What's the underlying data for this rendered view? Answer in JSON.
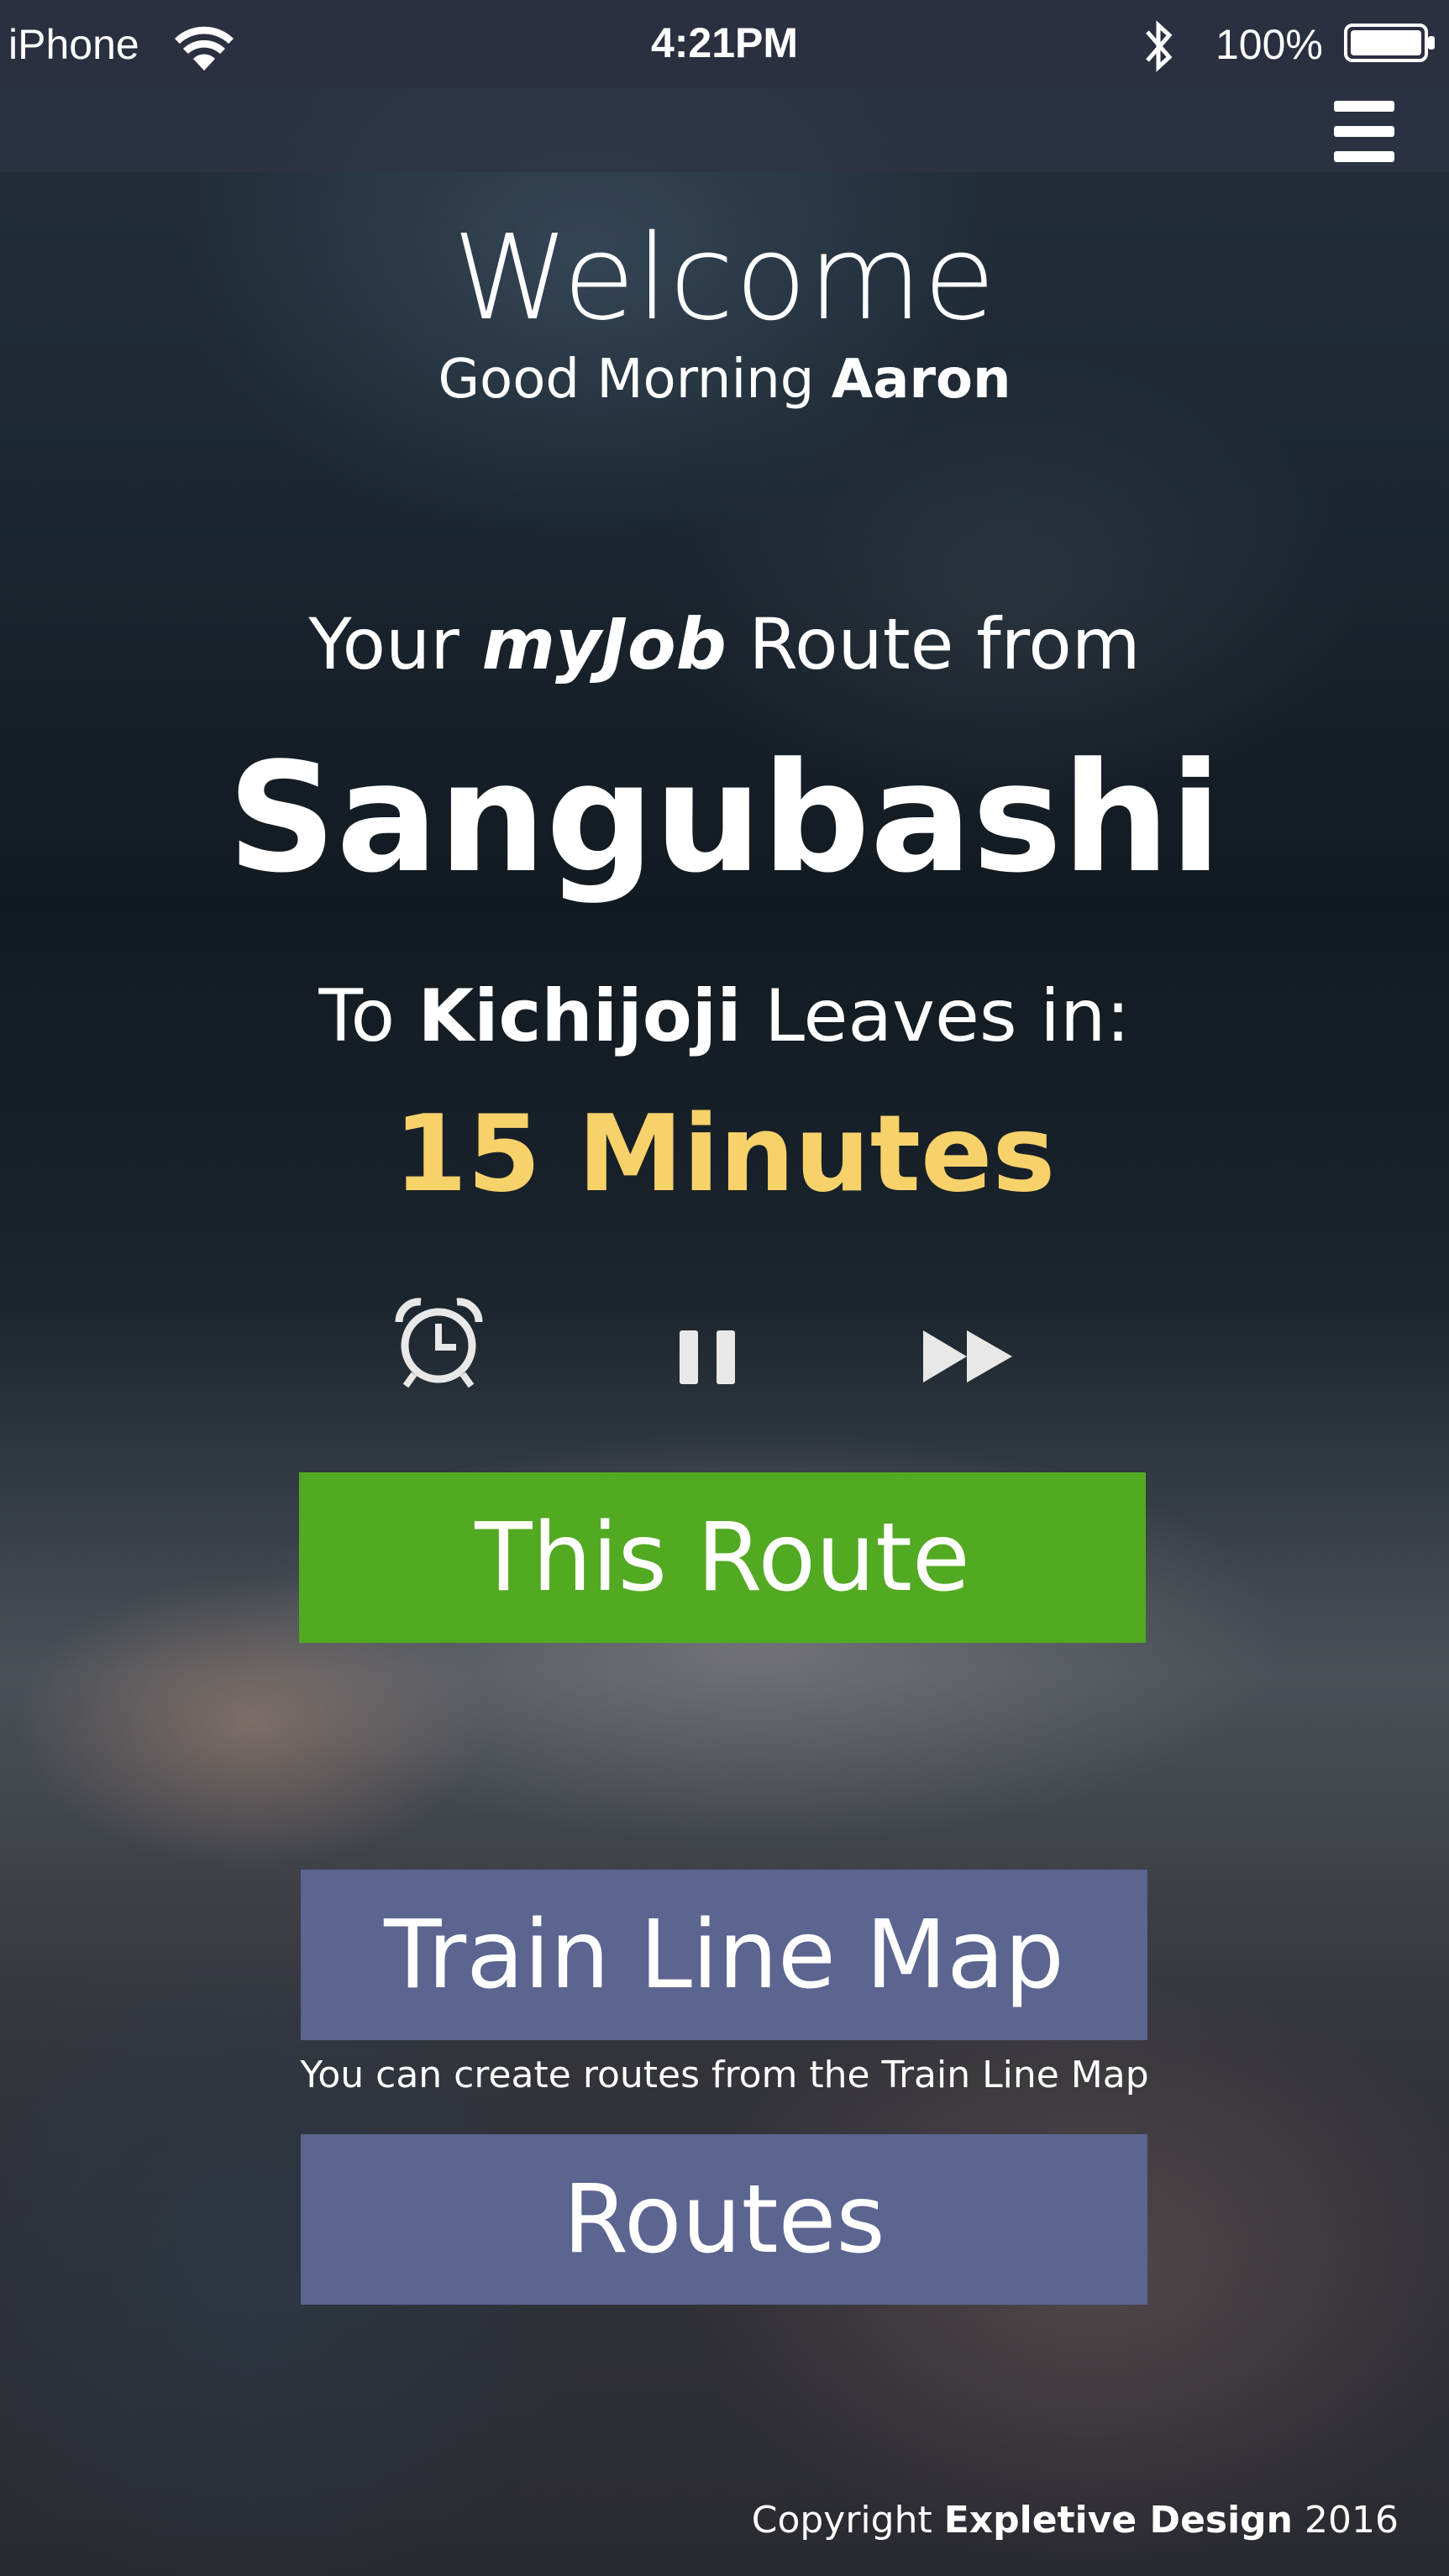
{
  "status_bar": {
    "carrier": "iPhone",
    "time": "4:21PM",
    "battery": "100%",
    "icons": [
      "wifi-icon",
      "bluetooth-icon",
      "battery-icon"
    ]
  },
  "nav": {
    "menu_icon": "hamburger-menu-icon"
  },
  "welcome": {
    "title": "Welcome",
    "greeting_prefix": "Good Morning",
    "user_name": "Aaron"
  },
  "route": {
    "prefix": "Your",
    "route_name": "myJob",
    "suffix": "Route from",
    "origin": "Sangubashi",
    "to_label": "To",
    "destination": "Kichijoji",
    "leaves_label": "Leaves in:",
    "countdown": "15 Minutes"
  },
  "controls": {
    "alarm_icon": "alarm-clock-icon",
    "pause_icon": "pause-icon",
    "forward_icon": "fast-forward-icon"
  },
  "buttons": {
    "this_route": "This Route",
    "train_line_map": "Train Line Map",
    "train_line_map_hint": "You can create routes from the Train Line Map",
    "routes": "Routes"
  },
  "footer": {
    "copyright_prefix": "Copyright",
    "company": "Expletive Design",
    "year": "2016"
  },
  "colors": {
    "countdown": "#f7d26a",
    "primary_button": "#52a922",
    "secondary_button": "#5c6490",
    "status_bar": "#2b3040"
  }
}
